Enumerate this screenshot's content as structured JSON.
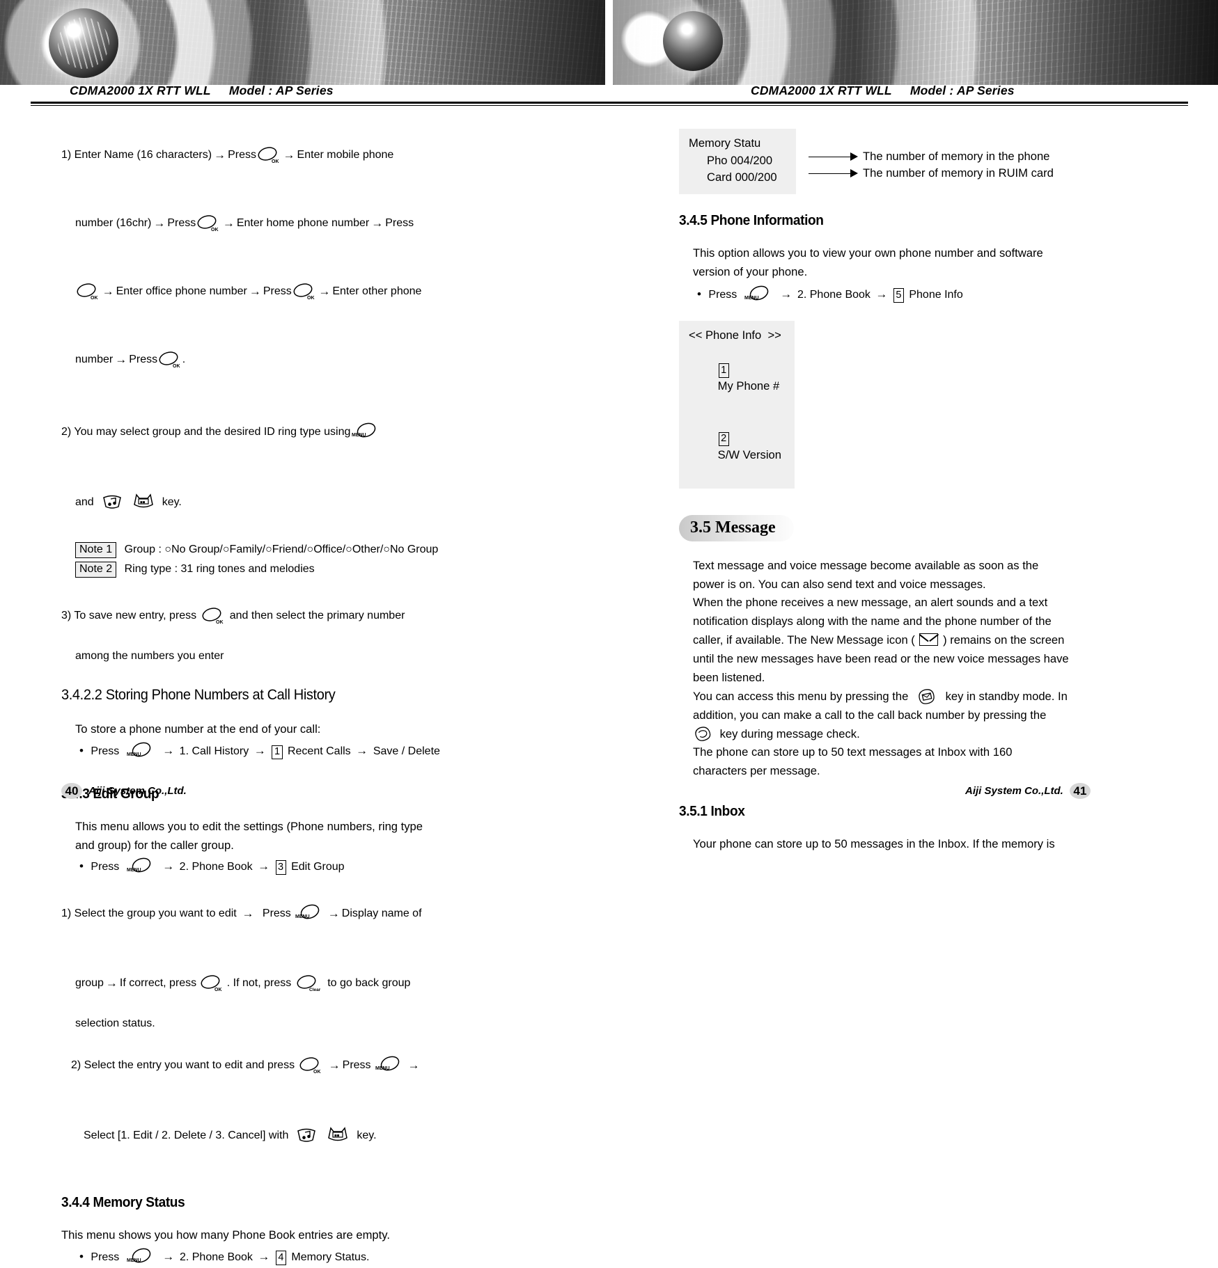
{
  "document": {
    "running_head": {
      "product": "CDMA2000 1X RTT WLL",
      "model": "Model :  AP Series"
    }
  },
  "left_page": {
    "page_number": "40",
    "footer_company": "Aiji System Co.,Ltd.",
    "steps_1": {
      "l1a": "1) Enter Name (16 characters)",
      "l1b": "Press",
      "l1c": "Enter mobile phone",
      "l2a": "number (16chr)",
      "l2b": "Press",
      "l2c": "Enter home phone number",
      "l2d": "Press",
      "l3a": "Enter office phone number",
      "l3b": "Press",
      "l3c": "Enter other phone",
      "l4a": "number",
      "l4b": "Press",
      "l4c": "."
    },
    "steps_2": {
      "l1": "2) You may select group and the desired ID ring type using",
      "l2a": "and",
      "l2b": "key."
    },
    "note1": {
      "tag": "Note 1",
      "text": "Group : ○No Group/○Family/○Friend/○Office/○Other/○No Group"
    },
    "note2": {
      "tag": "Note 2",
      "text": "Ring type : 31 ring tones and melodies"
    },
    "steps_3": {
      "l1a": "3) To save new entry, press",
      "l1b": "and then select the primary number",
      "l2": "among the numbers you enter"
    },
    "section_3422": {
      "heading": "3.4.2.2 Storing Phone Numbers at Call History",
      "intro": "To store a phone number at the end of your call:",
      "press_label": "Press",
      "path_1": "1. Call History",
      "key_num": "1",
      "path_2": "Recent Calls",
      "path_3": "Save / Delete"
    },
    "section_343": {
      "heading": "3.4.3 Edit Group",
      "intro_l1": "This menu allows you to edit the settings (Phone numbers, ring type",
      "intro_l2": "and group) for the caller group.",
      "press_label": "Press",
      "path_1": "2. Phone Book",
      "key_num": "3",
      "path_2": "Edit Group",
      "s1_l1a": "1) Select the group you want to edit",
      "s1_l1b": "Press",
      "s1_l1c": "Display name of",
      "s1_l2a": "group",
      "s1_l2b": "If correct, press",
      "s1_l2c": ". If not, press",
      "s1_l2d": "to go back group",
      "s1_l3": "selection status.",
      "s2_l1a": "2) Select the entry you want to edit and press",
      "s2_l1b": "Press",
      "s2_l2a": "Select [1. Edit / 2. Delete / 3. Cancel] with",
      "s2_l2b": "key."
    },
    "section_344": {
      "heading": "3.4.4 Memory Status",
      "intro": "This menu shows you how many Phone Book entries are empty.",
      "press_label": "Press",
      "path_1": "2. Phone Book",
      "key_num": "4",
      "path_2": "Memory Status."
    }
  },
  "right_page": {
    "page_number": "41",
    "footer_company": "Aiji System Co.,Ltd.",
    "memory_figure": {
      "lcd_title": "Memory Statu",
      "lcd_row1": "Pho 004/200",
      "lcd_row2": "Card 000/200",
      "callout1": "The number of memory in the phone",
      "callout2": "The number of memory in RUIM card"
    },
    "section_345": {
      "heading": "3.4.5 Phone Information",
      "intro_l1": "This option allows you to view your own phone number and software",
      "intro_l2": "version of your phone.",
      "press_label": "Press",
      "path_1": "2. Phone Book",
      "key_num": "5",
      "path_2": "Phone Info",
      "lcd_title": "<< Phone Info  >>",
      "lcd_item1_num": "1",
      "lcd_item1": "My Phone #",
      "lcd_item2_num": "2",
      "lcd_item2": "S/W Version"
    },
    "section_35": {
      "heading": "3.5 Message",
      "p_l1": "Text message and voice message become available as soon as the",
      "p_l2": "power is on. You can also send text and voice messages.",
      "p_l3": "When the phone receives a new message, an alert sounds and a text",
      "p_l4": "notification displays along with the name and the phone number of the",
      "p_l5a": "caller, if available. The New Message icon (",
      "p_l5b": ") remains on the screen",
      "p_l6": "until the new messages have been read or the new voice messages have",
      "p_l7": "been listened.",
      "p_l8a": "You can access this menu by pressing the",
      "p_l8b": "key in standby mode. In",
      "p_l9": "addition, you can make a call to the call back number by pressing the",
      "p_l10": "key during message check.",
      "p_l11": "The phone can store up to 50 text messages at Inbox with 160",
      "p_l12": "characters per message."
    },
    "section_351": {
      "heading": "3.5.1 Inbox",
      "intro": "Your phone can store up to 50 messages in the Inbox. If the memory is"
    }
  }
}
